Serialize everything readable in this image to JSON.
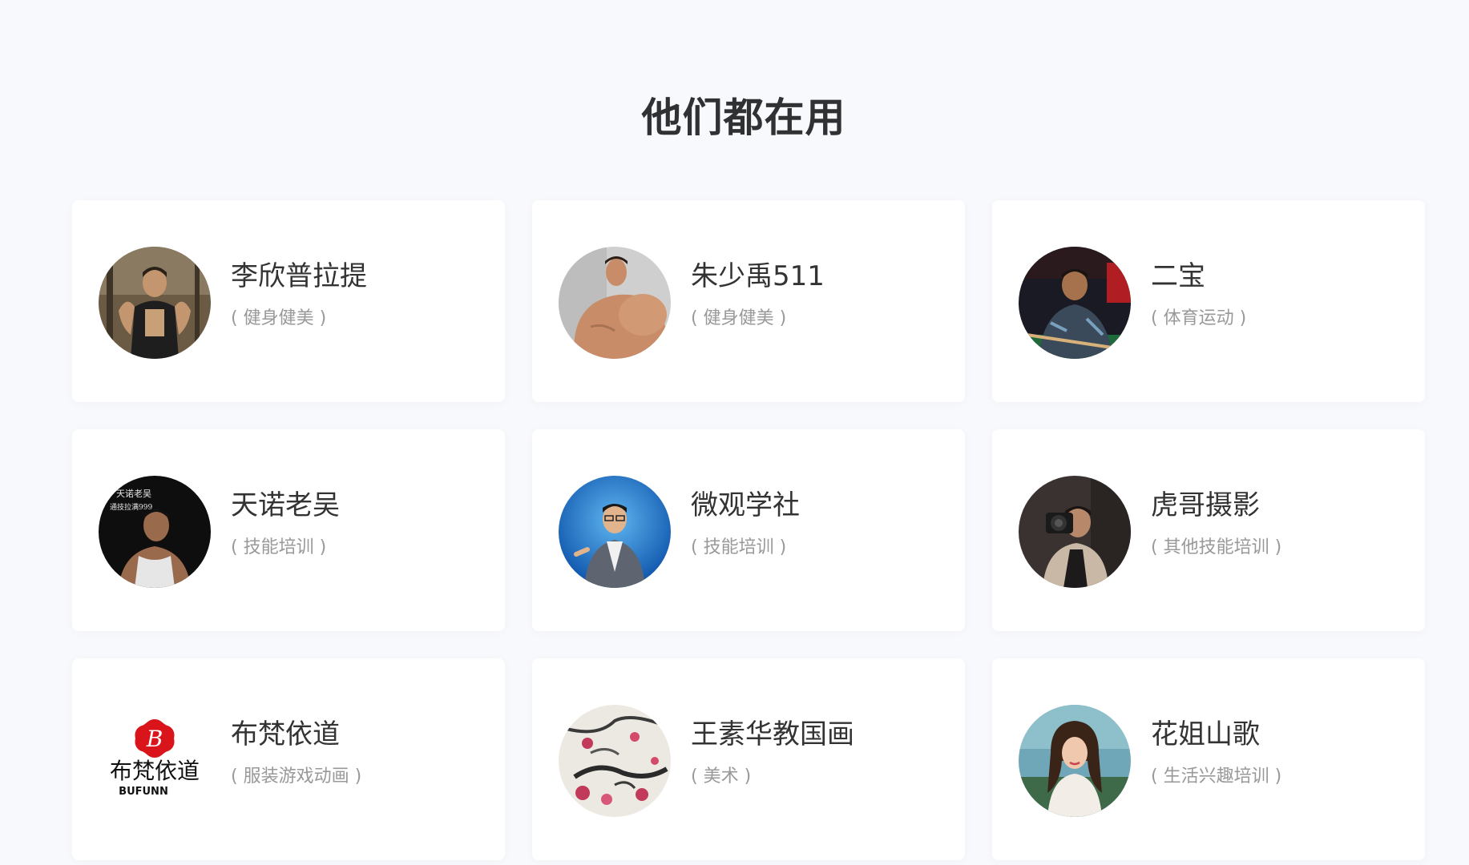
{
  "section": {
    "title": "他们都在用"
  },
  "cards": [
    {
      "name": "李欣普拉提",
      "category": "( 健身健美 )",
      "avatar": "fitness-portrait"
    },
    {
      "name": "朱少禹511",
      "category": "( 健身健美 )",
      "avatar": "bodybuilder-portrait"
    },
    {
      "name": "二宝",
      "category": "( 体育运动 )",
      "avatar": "billiards-portrait"
    },
    {
      "name": "天诺老吴",
      "category": "( 技能培训 )",
      "avatar": "tank-top-portrait"
    },
    {
      "name": "微观学社",
      "category": "( 技能培训 )",
      "avatar": "speaker-portrait"
    },
    {
      "name": "虎哥摄影",
      "category": "( 其他技能培训 )",
      "avatar": "photographer-portrait"
    },
    {
      "name": "布梵依道",
      "category": "( 服装游戏动画 )",
      "avatar": "brand-logo",
      "logo_text": "布梵依道",
      "logo_sub": "BUFUNN"
    },
    {
      "name": "王素华教国画",
      "category": "( 美术 )",
      "avatar": "ink-painting"
    },
    {
      "name": "花姐山歌",
      "category": "( 生活兴趣培训 )",
      "avatar": "woman-portrait"
    }
  ],
  "colors": {
    "background": "#f8f9fc",
    "card": "#ffffff",
    "title": "#303133",
    "name": "#333333",
    "category": "#999999",
    "logo_red": "#d9141b"
  }
}
